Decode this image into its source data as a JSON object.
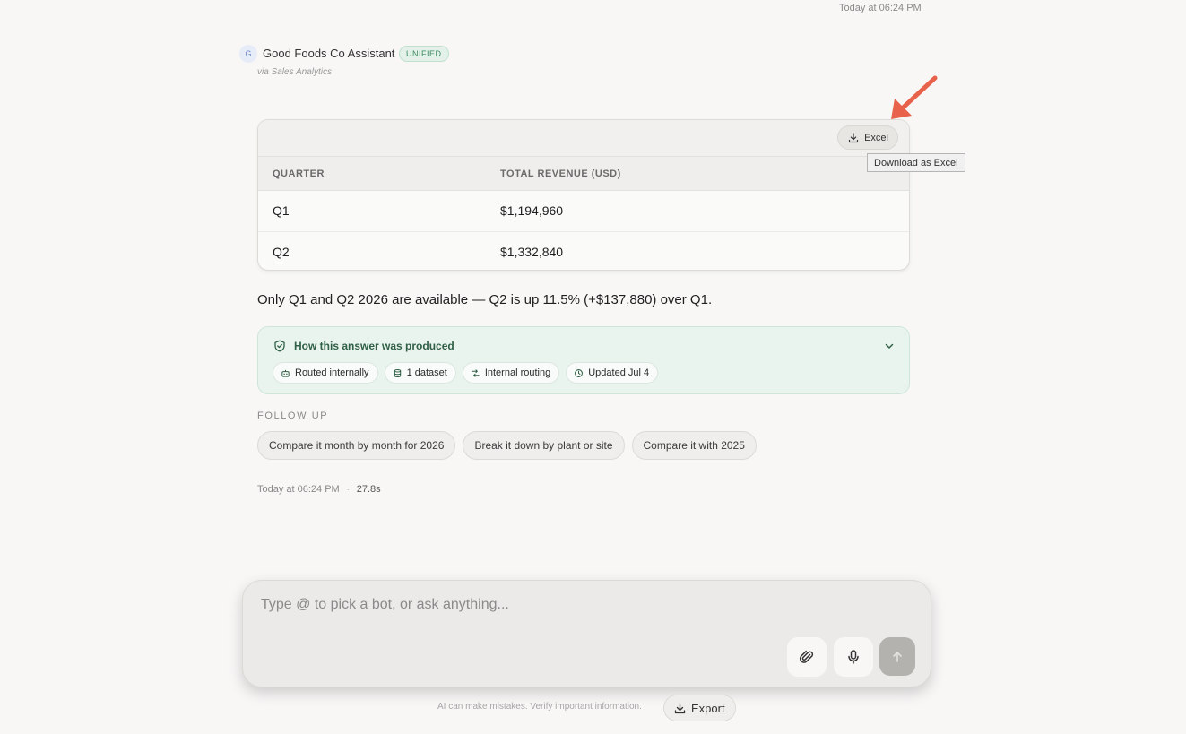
{
  "timestamps": {
    "top": "Today at 06:24 PM"
  },
  "bot": {
    "avatar_letter": "G",
    "name": "Good Foods Co Assistant",
    "badge": "UNIFIED",
    "source": "via Sales Analytics"
  },
  "table": {
    "excel_button": "Excel",
    "excel_tooltip": "Download as Excel",
    "columns": [
      "QUARTER",
      "TOTAL REVENUE (USD)"
    ],
    "rows": [
      [
        "Q1",
        "$1,194,960"
      ],
      [
        "Q2",
        "$1,332,840"
      ]
    ]
  },
  "answer": "Only Q1 and Q2 2026 are available — Q2 is up 11.5% (+$137,880) over Q1.",
  "provenance": {
    "title": "How this answer was produced",
    "chips": [
      {
        "label": "Routed internally",
        "icon": "robot-icon"
      },
      {
        "label": "1 dataset",
        "icon": "database-icon"
      },
      {
        "label": "Internal routing",
        "icon": "route-icon"
      },
      {
        "label": "Updated Jul 4",
        "icon": "clock-icon"
      }
    ]
  },
  "follow_up": {
    "label": "FOLLOW UP",
    "items": [
      "Compare it month by month for 2026",
      "Break it down by plant or site",
      "Compare it with 2025"
    ]
  },
  "meta": {
    "timestamp": "Today at 06:24 PM",
    "separator": "·",
    "duration": "27.8s"
  },
  "composer": {
    "placeholder": "Type @ to pick a bot, or ask anything...",
    "attach_icon": "paperclip-icon",
    "mic_icon": "microphone-icon",
    "send_icon": "arrow-up-icon"
  },
  "footer": {
    "disclaimer": "AI can make mistakes. Verify important information.",
    "export_label": "Export"
  },
  "colors": {
    "background": "#f8f7f6",
    "accent_green": "#2f5f45",
    "annotation_arrow": "#e8614a"
  }
}
